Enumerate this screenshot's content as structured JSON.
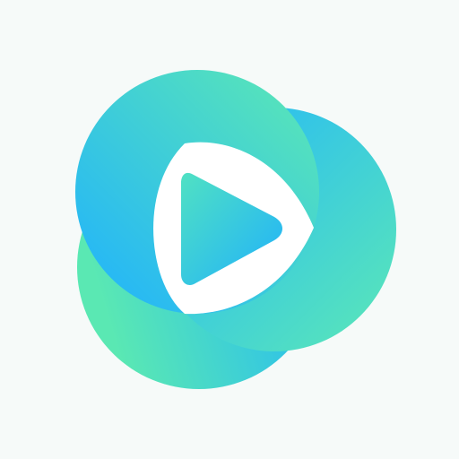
{
  "app_icon": {
    "icon": "video-player-logo-icon",
    "background_color": "#f6faf9",
    "colors": {
      "teal": "#56e6b6",
      "cyan": "#36d2df",
      "blue": "#22b6fb",
      "sky": "#28beef",
      "play": "#ffffff"
    }
  }
}
